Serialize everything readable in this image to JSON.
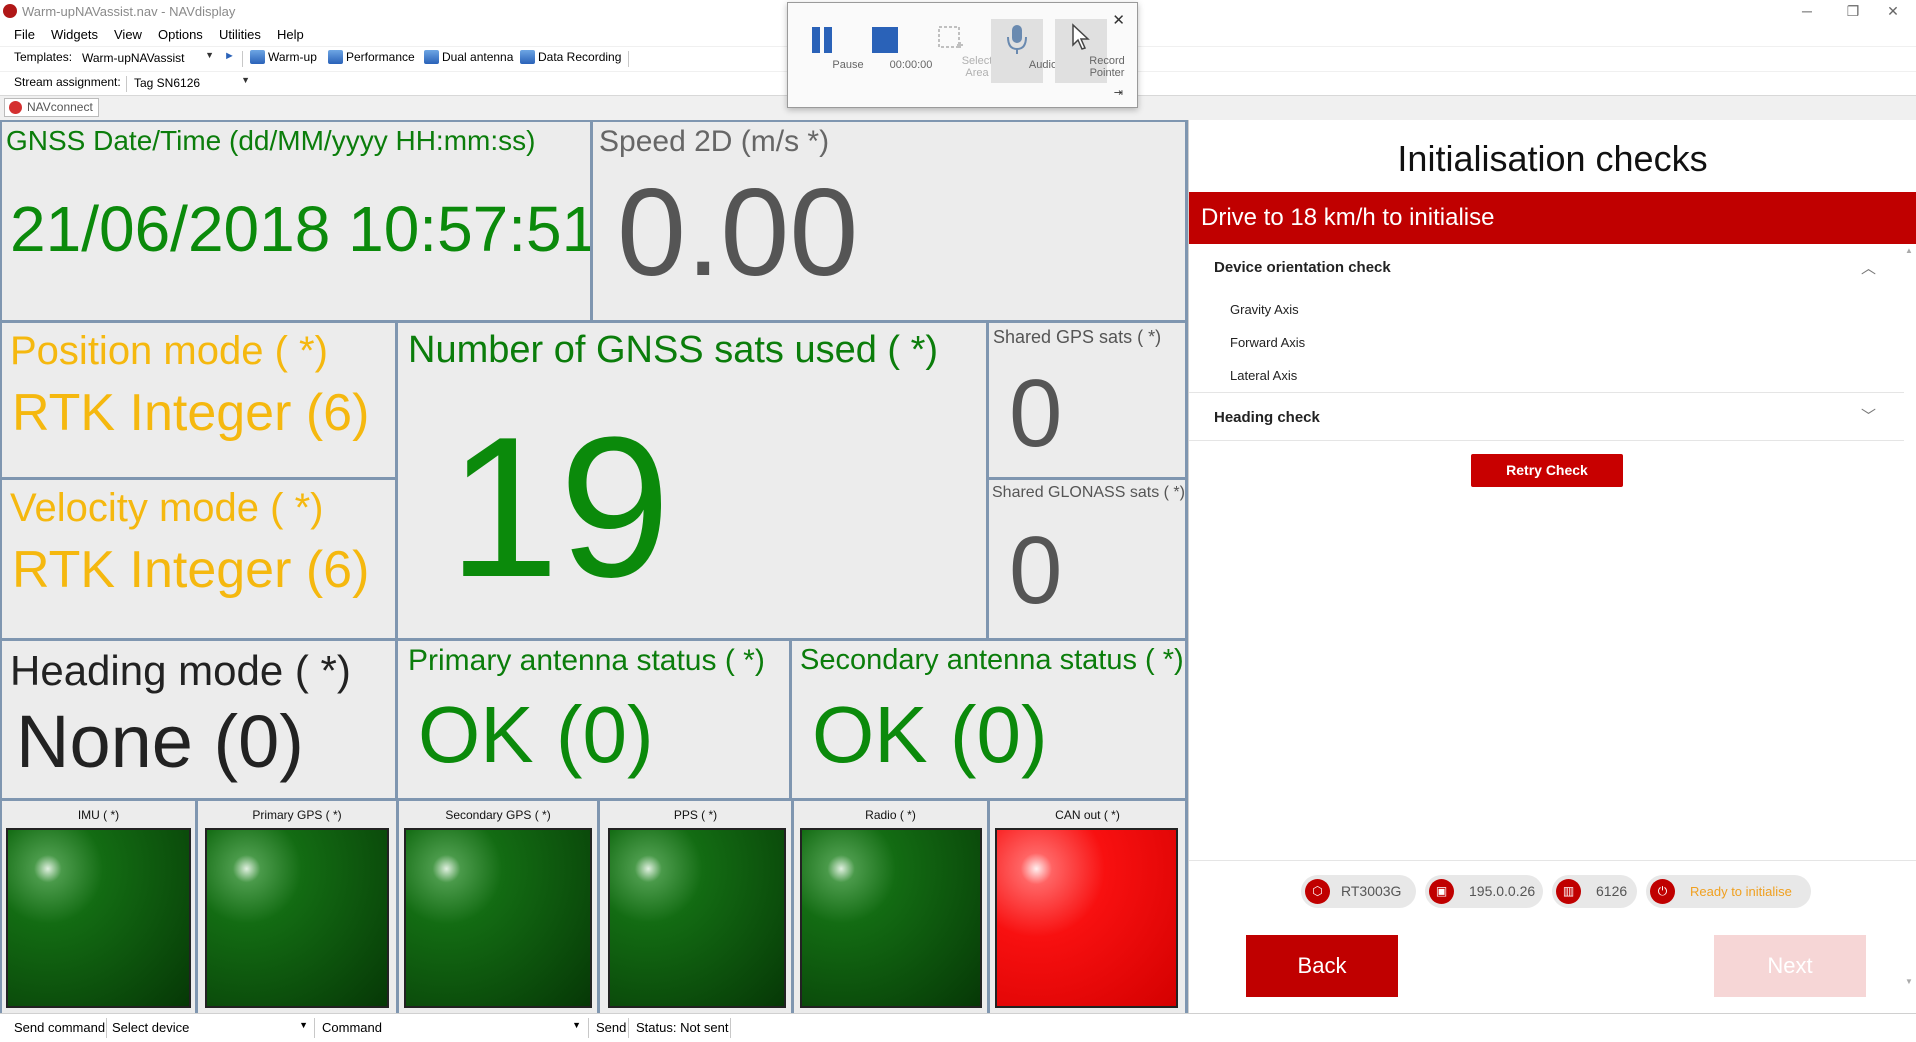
{
  "window": {
    "title": "Warm-upNAVassist.nav - NAVdisplay",
    "minimize": "─",
    "restore": "❐",
    "close": "✕"
  },
  "menu": [
    "File",
    "Widgets",
    "View",
    "Options",
    "Utilities",
    "Help"
  ],
  "toolbar": {
    "templates_label": "Templates:",
    "template_value": "Warm-upNAVassist",
    "buttons": [
      "Warm-up",
      "Performance",
      "Dual antenna",
      "Data Recording"
    ],
    "stream_label": "Stream assignment:",
    "stream_value": "Tag SN6126"
  },
  "tab": {
    "label": "NAVconnect"
  },
  "recorder": {
    "pause_label": "Pause",
    "time": "00:00:00",
    "select_area_label": "Select\nArea",
    "audio_label": "Audio",
    "record_pointer_label": "Record\nPointer"
  },
  "dashboard": {
    "datetime": {
      "label": "GNSS Date/Time (dd/MM/yyyy HH:mm:ss)",
      "value": "21/06/2018 10:57:51"
    },
    "speed": {
      "label": "Speed 2D (m/s *)",
      "value": "0.00"
    },
    "position_mode": {
      "label": "Position mode ( *)",
      "value": "RTK Integer (6)"
    },
    "velocity_mode": {
      "label": "Velocity mode ( *)",
      "value": "RTK Integer (6)"
    },
    "sats_used": {
      "label": "Number of GNSS sats used ( *)",
      "value": "19"
    },
    "shared_gps": {
      "label": "Shared GPS sats ( *)",
      "value": "0"
    },
    "shared_glonass": {
      "label": "Shared GLONASS sats ( *)",
      "value": "0"
    },
    "heading_mode": {
      "label": "Heading mode ( *)",
      "value": "None (0)"
    },
    "primary_antenna": {
      "label": "Primary antenna status ( *)",
      "value": "OK (0)"
    },
    "secondary_antenna": {
      "label": "Secondary antenna status ( *)",
      "value": "OK (0)"
    },
    "lights": [
      {
        "label": "IMU ( *)",
        "state": "green"
      },
      {
        "label": "Primary GPS ( *)",
        "state": "green"
      },
      {
        "label": "Secondary GPS ( *)",
        "state": "green"
      },
      {
        "label": "PPS ( *)",
        "state": "green"
      },
      {
        "label": "Radio ( *)",
        "state": "green"
      },
      {
        "label": "CAN out ( *)",
        "state": "red"
      }
    ]
  },
  "init": {
    "title": "Initialisation checks",
    "alert": "Drive to 18 km/h to initialise",
    "orientation_check": "Device orientation check",
    "axes": [
      "Gravity Axis",
      "Forward Axis",
      "Lateral Axis"
    ],
    "heading_check": "Heading check",
    "retry_button": "Retry Check",
    "device": "RT3003G",
    "ip": "195.0.0.26",
    "serial": "6126",
    "status": "Ready to initialise",
    "back_button": "Back",
    "next_button": "Next"
  },
  "statusbar": {
    "send_command": "Send command",
    "select_device": "Select device",
    "command": "Command",
    "send": "Send",
    "status": "Status: Not sent"
  },
  "colors": {
    "label_green": "#0b7d0b",
    "value_green": "#0b8a0b",
    "label_yellow": "#f5b80f",
    "red": "#c00000",
    "status_orange": "#f0a020"
  }
}
